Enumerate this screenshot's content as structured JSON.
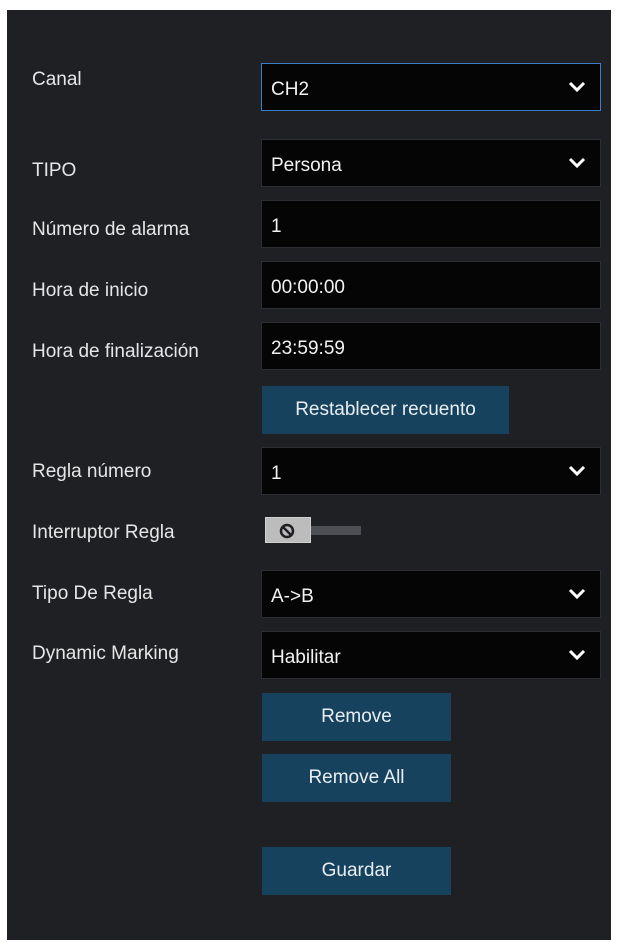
{
  "form": {
    "channel": {
      "label": "Canal",
      "value": "CH2"
    },
    "type": {
      "label": "TIPO",
      "value": "Persona"
    },
    "alarm_number": {
      "label": "Número de alarma",
      "value": "1"
    },
    "start_time": {
      "label": "Hora de inicio",
      "value": "00:00:00"
    },
    "end_time": {
      "label": "Hora de finalización",
      "value": "23:59:59"
    },
    "reset_count_label": "Restablecer recuento",
    "rule_number": {
      "label": "Regla número",
      "value": "1"
    },
    "rule_switch": {
      "label": "Interruptor Regla",
      "state": "off"
    },
    "rule_type": {
      "label": "Tipo De Regla",
      "value": "A->B"
    },
    "dynamic_marking": {
      "label": "Dynamic Marking",
      "value": "Habilitar"
    }
  },
  "buttons": {
    "remove_label": "Remove",
    "remove_all_label": "Remove All",
    "save_label": "Guardar"
  },
  "colors": {
    "panel_bg": "#1f2024",
    "field_bg": "#050505",
    "button_bg": "#17425e",
    "focus_border": "#3a80c8"
  }
}
